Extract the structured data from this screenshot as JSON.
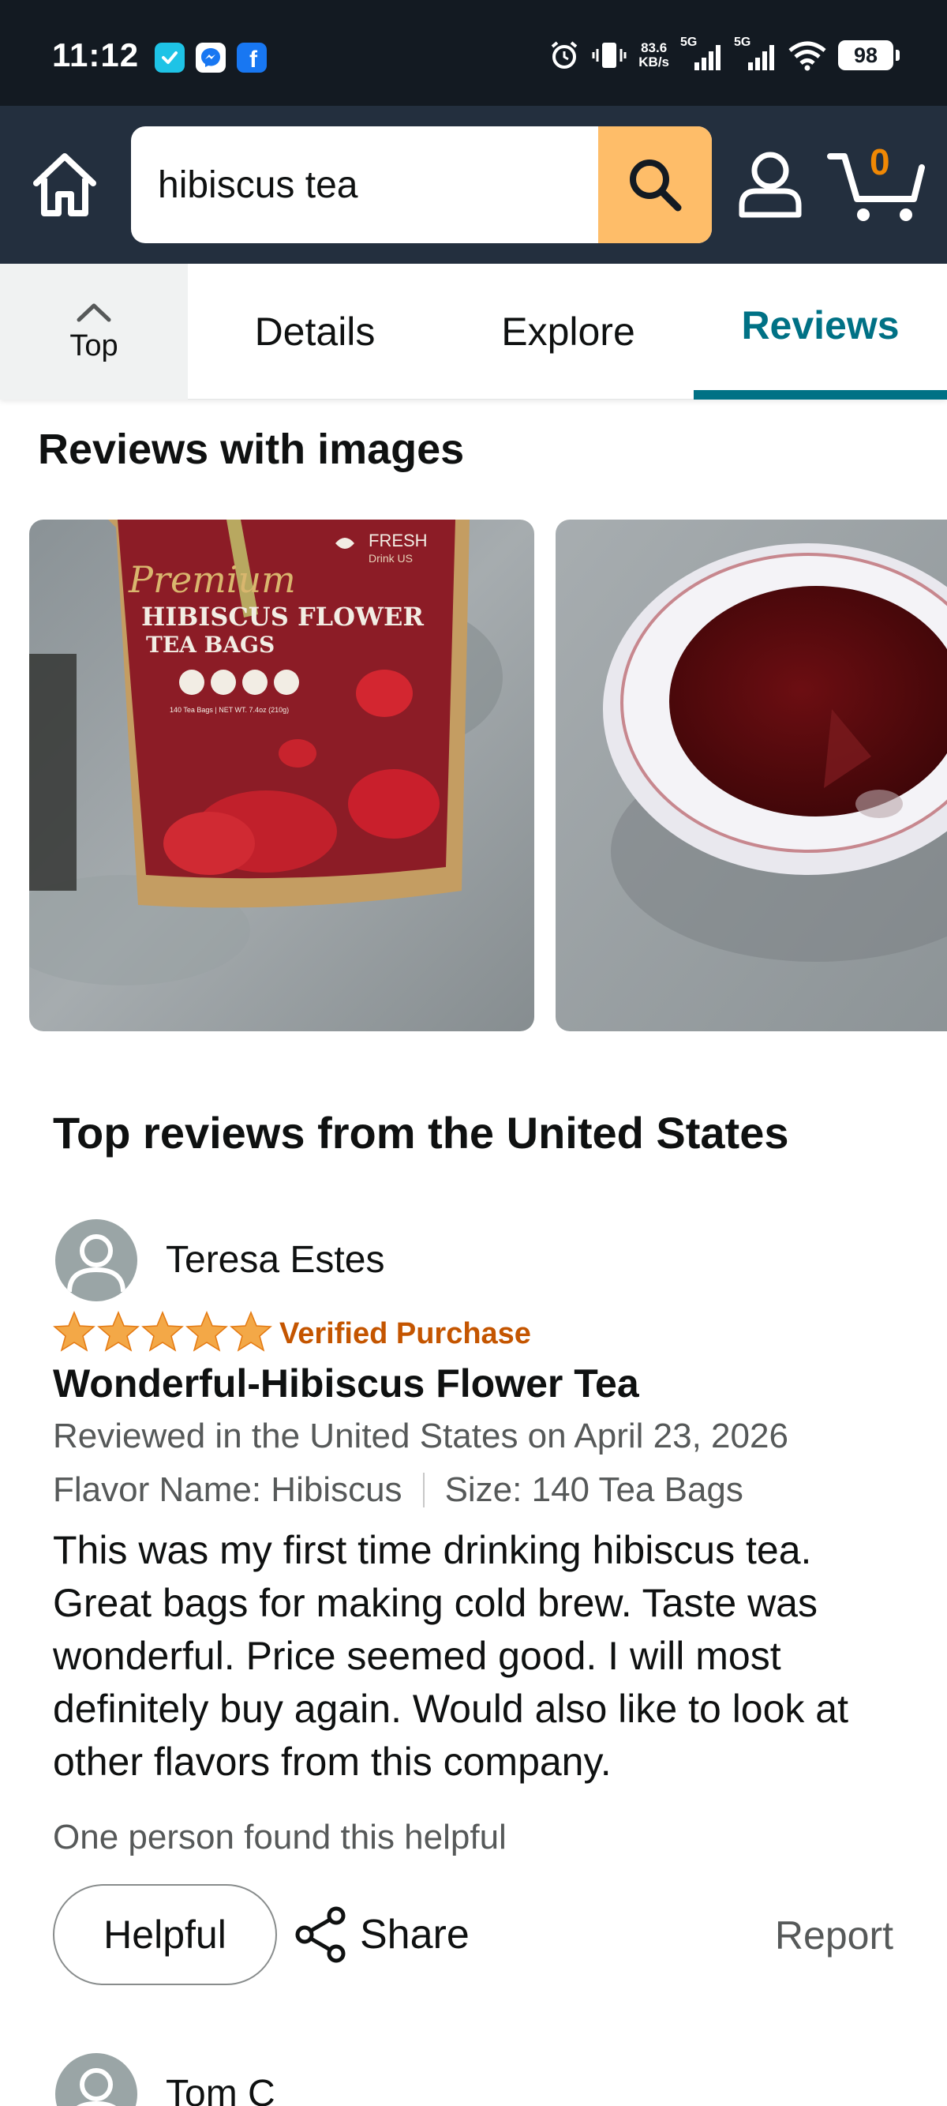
{
  "status_bar": {
    "time": "11:12",
    "net_speed_value": "83.6",
    "net_speed_unit": "KB/s",
    "signal_1": "5G",
    "signal_2": "5G",
    "battery": "98"
  },
  "header": {
    "search_value": "hibiscus tea",
    "cart_count": "0"
  },
  "tabs": {
    "top_label": "Top",
    "items": [
      "Details",
      "Explore",
      "Reviews"
    ],
    "active": "Reviews"
  },
  "reviews_with_images": {
    "title": "Reviews with images"
  },
  "top_reviews": {
    "title": "Top reviews from the United States",
    "review": {
      "reviewer": "Teresa Estes",
      "rating": 5,
      "verified": "Verified Purchase",
      "title": "Wonderful-Hibiscus Flower Tea",
      "date": "Reviewed in the United States on April 23, 2026",
      "flavor": "Flavor Name: Hibiscus",
      "size": "Size: 140 Tea Bags",
      "body": "This was my first time drinking hibiscus tea. Great bags for making cold brew. Taste was wonderful. Price seemed good. I will most definitely buy again. Would also like to look at other flavors from this company.",
      "helpful_count": "One person found this helpful",
      "helpful_label": "Helpful",
      "share_label": "Share",
      "report_label": "Report"
    },
    "next_reviewer": "Tom C"
  },
  "colors": {
    "header_bg": "#232f3e",
    "status_bg": "#131a22",
    "search_button": "#febd69",
    "cart_count": "#f08804",
    "active_tab": "#007185",
    "star": "#f3a847",
    "verified": "#c45500"
  },
  "package_text": {
    "brand": "FRESH",
    "brand_sub": "Drink US",
    "script": "Premium",
    "line1": "HIBISCUS FLOWER",
    "line2": "TEA BAGS",
    "small": "140 Tea Bags | NET WT. 7.4oz (210g)"
  }
}
